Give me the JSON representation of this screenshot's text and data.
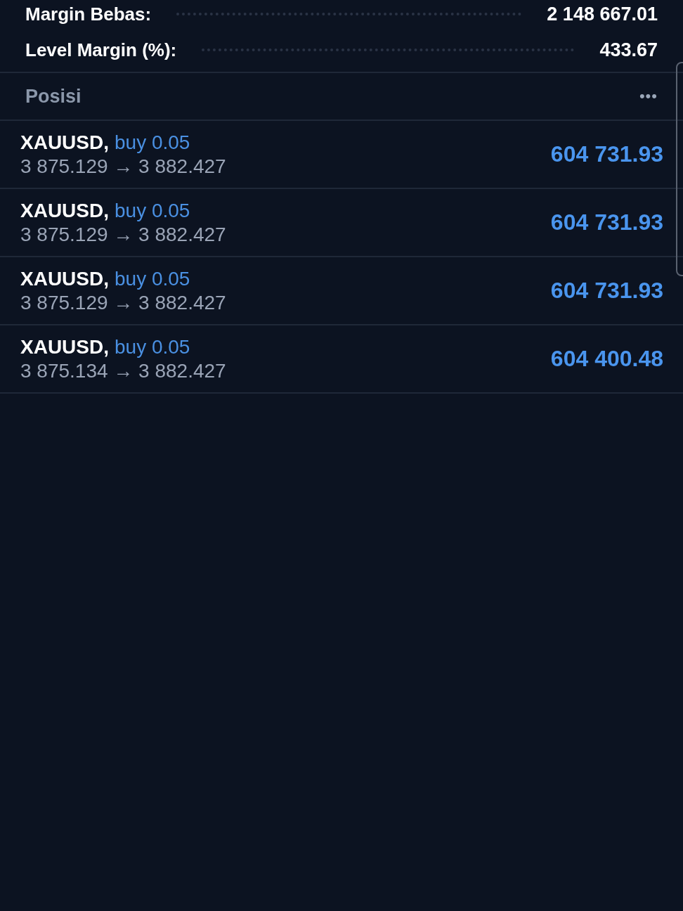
{
  "account": [
    {
      "label": "Margin Bebas:",
      "value": "2 148 667.01"
    },
    {
      "label": "Level Margin (%):",
      "value": "433.67"
    }
  ],
  "positions": {
    "title": "Posisi",
    "menu": "•••",
    "rows": [
      {
        "symbol": "XAUUSD,",
        "trade": "buy 0.05",
        "prices": "3 875.129 → 3 882.427",
        "profit": "604 731.93"
      },
      {
        "symbol": "XAUUSD,",
        "trade": "buy 0.05",
        "prices": "3 875.129 → 3 882.427",
        "profit": "604 731.93"
      },
      {
        "symbol": "XAUUSD,",
        "trade": "buy 0.05",
        "prices": "3 875.129 → 3 882.427",
        "profit": "604 731.93"
      },
      {
        "symbol": "XAUUSD,",
        "trade": "buy 0.05",
        "prices": "3 875.134 → 3 882.427",
        "profit": "604 400.48"
      }
    ]
  }
}
